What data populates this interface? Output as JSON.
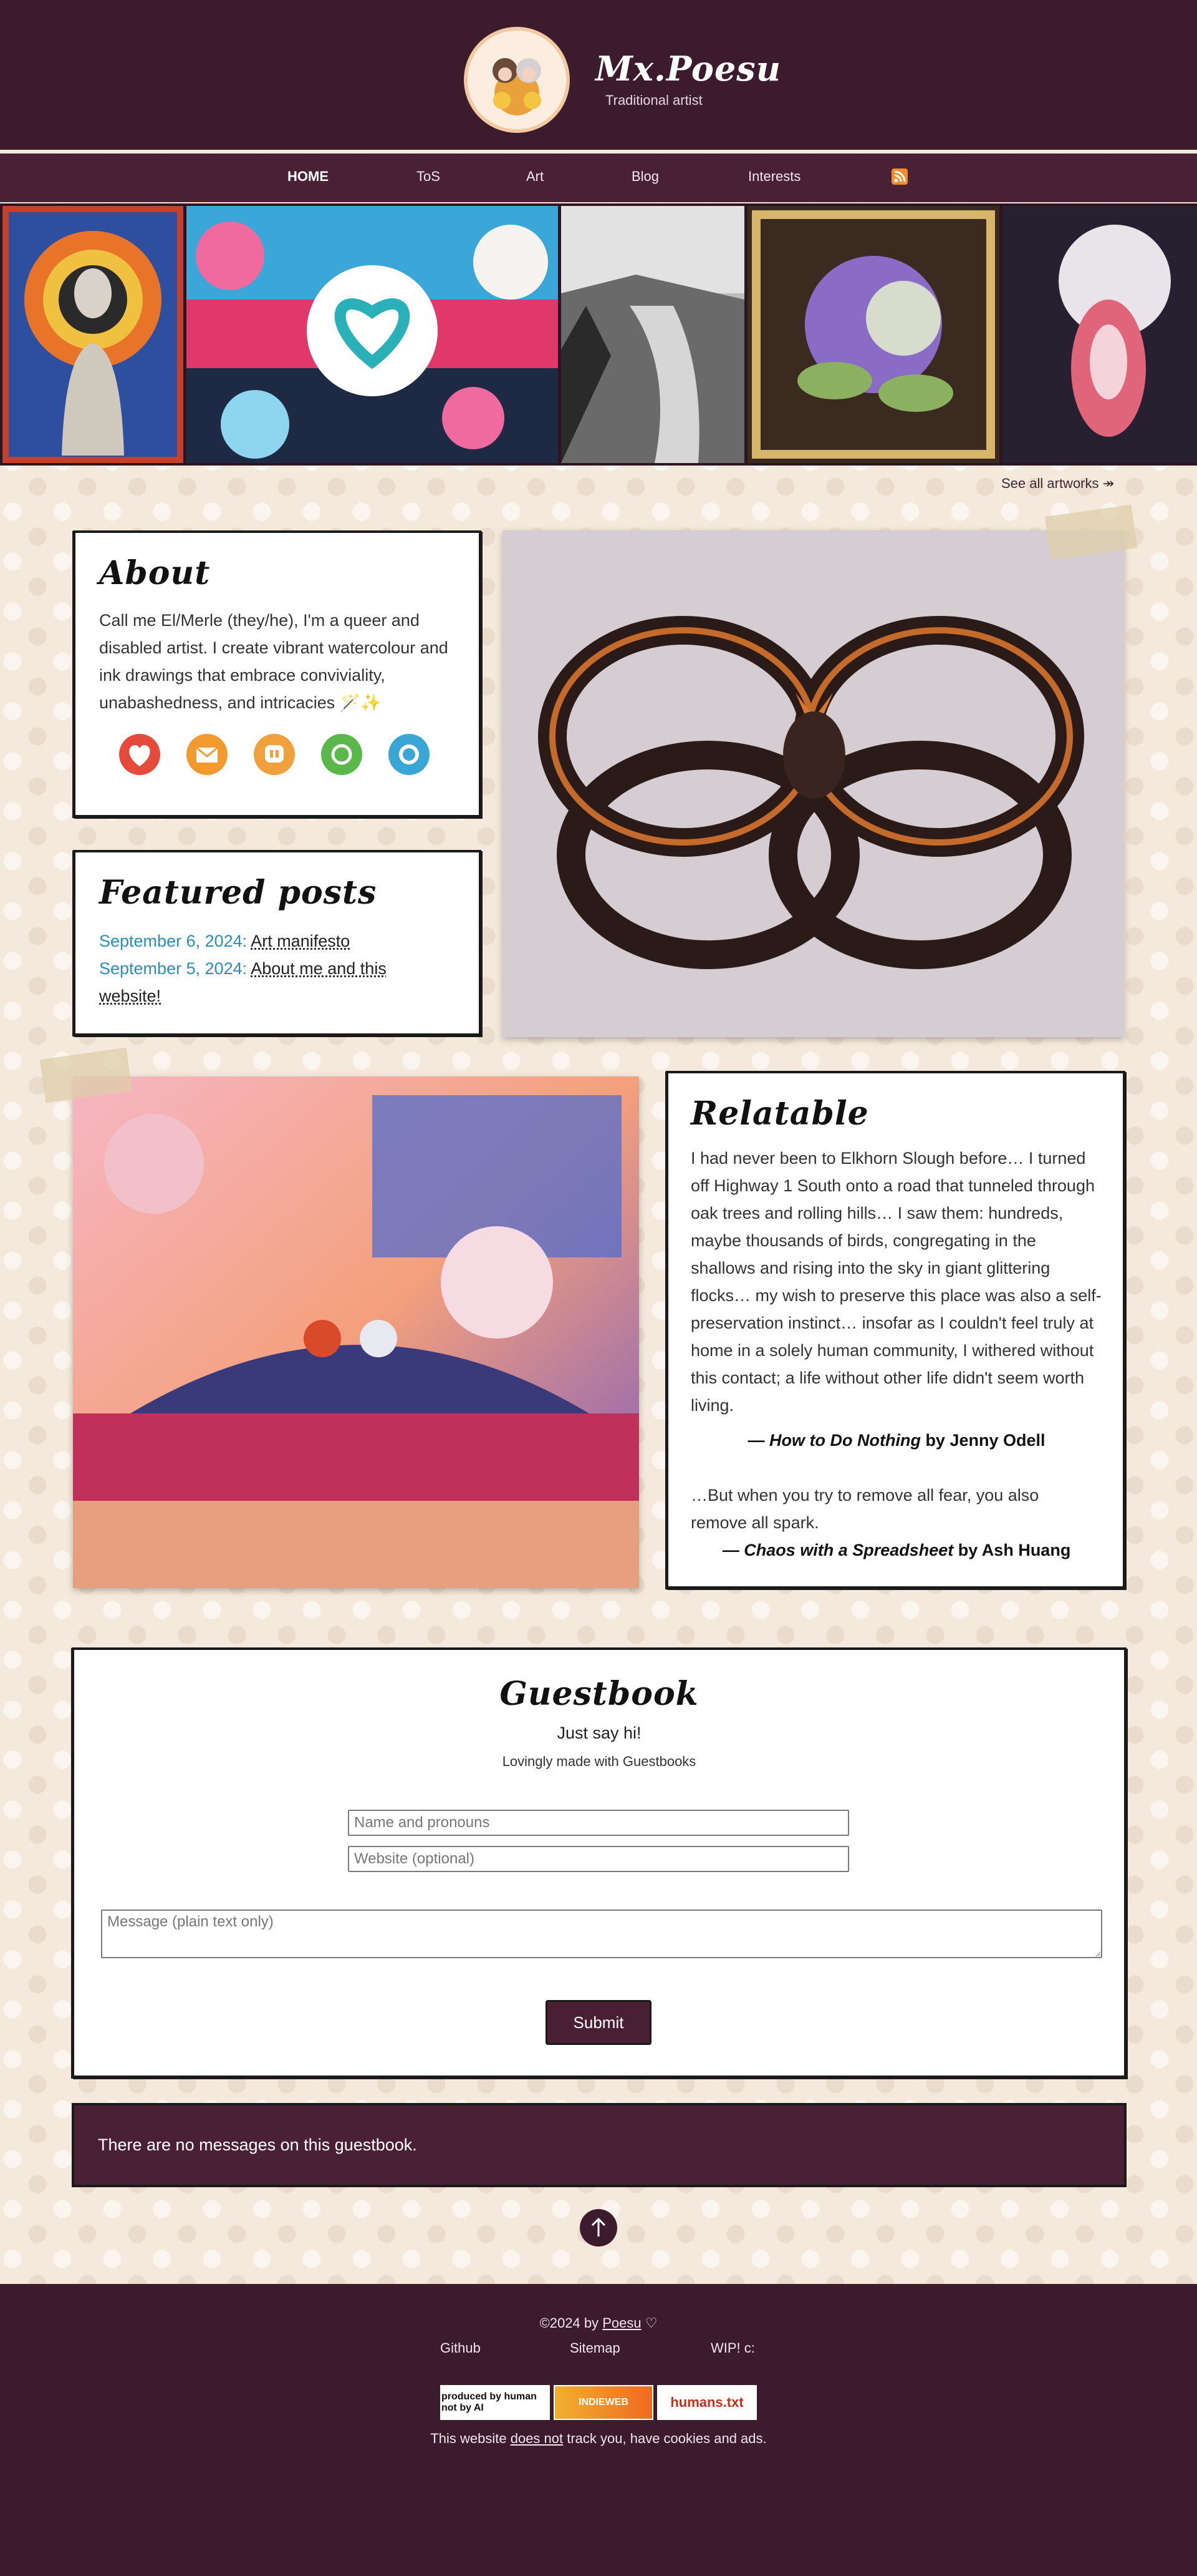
{
  "header": {
    "title": "Mx.Poesu",
    "subtitle": "Traditional artist"
  },
  "nav": {
    "items": [
      {
        "label": "HOME",
        "active": true
      },
      {
        "label": "ToS",
        "active": false
      },
      {
        "label": "Art",
        "active": false
      },
      {
        "label": "Blog",
        "active": false
      },
      {
        "label": "Interests",
        "active": false
      }
    ],
    "rss_icon": "rss-feed-icon"
  },
  "gallery": {
    "see_all": "See all artworks ↠"
  },
  "about": {
    "title": "About",
    "text": "Call me El/Merle (they/he), I'm a queer and disabled artist. I create vibrant watercolour and ink drawings that embrace conviviality, unabashedness, and intricacies 🪄✨",
    "socials": [
      {
        "icon": "kofi-heart-icon",
        "color": "#e64a3a"
      },
      {
        "icon": "mail-envelope-icon",
        "color": "#f39a2e"
      },
      {
        "icon": "mastodon-icon",
        "color": "#f0a03c"
      },
      {
        "icon": "refresh-arrows-icon",
        "color": "#5ab84a"
      },
      {
        "icon": "bluesky-chat-icon",
        "color": "#3aa6d6"
      }
    ]
  },
  "featured": {
    "title": "Featured posts",
    "posts": [
      {
        "date": "September 6, 2024:",
        "title": "Art manifesto"
      },
      {
        "date": "September 5, 2024:",
        "title": "About me and this website!"
      }
    ]
  },
  "relatable": {
    "title": "Relatable",
    "quote1": "I had never been to Elkhorn Slough before… I turned off Highway 1 South onto a road that tunneled through oak trees and rolling hills… I saw them: hundreds, maybe thousands of birds, congregating in the shallows and rising into the sky in giant glittering flocks… my wish to preserve this place was also a self-preservation instinct… insofar as I couldn't feel truly at home in a solely human community, I withered without this contact; a life without other life didn't seem worth living.",
    "cite1_dash": "— ",
    "cite1_book": "How to Do Nothing",
    "cite1_author": " by Jenny Odell",
    "quote2": "…But when you try to remove all fear, you also remove all spark.",
    "cite2_dash": "— ",
    "cite2_book": "Chaos with a Spreadsheet",
    "cite2_author": " by Ash Huang"
  },
  "guestbook": {
    "title": "Guestbook",
    "subtitle": "Just say hi!",
    "made_with": "Lovingly made with Guestbooks",
    "name_placeholder": "Name and pronouns",
    "website_placeholder": "Website (optional)",
    "message_placeholder": "Message (plain text only)",
    "submit_label": "Submit",
    "empty_message": "There are no messages on this guestbook."
  },
  "footer": {
    "copyright_prefix": "©2024 by ",
    "copyright_name": "Poesu",
    "copyright_suffix": " ♡",
    "links": [
      "Github",
      "Sitemap",
      "WIP! c:"
    ],
    "badges": [
      {
        "label": "produced by human not by AI"
      },
      {
        "label": "INDIEWEB"
      },
      {
        "label": "humans.txt"
      }
    ],
    "tracking_prefix": "This website ",
    "tracking_link": "does not",
    "tracking_suffix": " track you, have cookies and ads."
  },
  "colors": {
    "header_bg": "#3c1b2c",
    "nav_bg": "#4a2035",
    "accent_blue": "#2b8fb3",
    "page_bg": "#f4e9dc"
  }
}
